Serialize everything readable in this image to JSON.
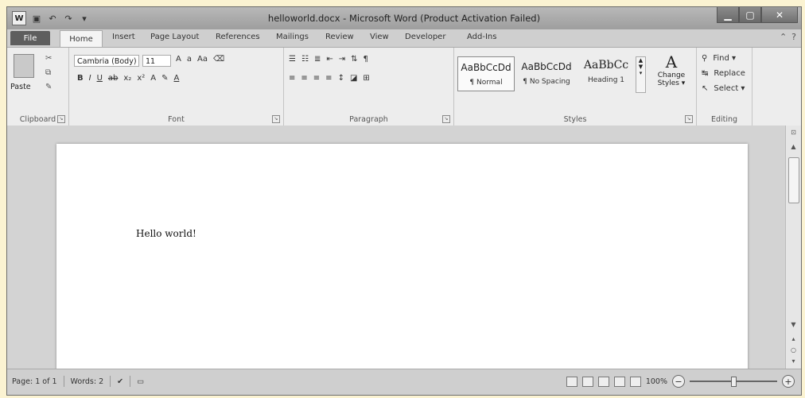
{
  "window": {
    "title": "helloworld.docx - Microsoft Word (Product Activation Failed)"
  },
  "qat": {
    "logo": "W"
  },
  "tabs": [
    "File",
    "Home",
    "Insert",
    "Page Layout",
    "References",
    "Mailings",
    "Review",
    "View",
    "Developer",
    "Add-Ins"
  ],
  "ribbon": {
    "clipboard": {
      "paste_label": "Paste",
      "group_label": "Clipboard"
    },
    "font": {
      "font_name": "Cambria (Body)",
      "font_size": "11",
      "group_label": "Font"
    },
    "paragraph": {
      "group_label": "Paragraph"
    },
    "styles": {
      "items": [
        {
          "preview": "AaBbCcDd",
          "name": "¶ Normal"
        },
        {
          "preview": "AaBbCcDd",
          "name": "¶ No Spacing"
        },
        {
          "preview": "AaBbCc",
          "name": "Heading 1"
        }
      ],
      "change_styles": "Change Styles ▾",
      "group_label": "Styles"
    },
    "editing": {
      "find": "Find ▾",
      "replace": "Replace",
      "select": "Select ▾",
      "group_label": "Editing"
    }
  },
  "document": {
    "text": "Hello world!"
  },
  "status": {
    "page": "Page: 1 of 1",
    "words": "Words: 2",
    "zoom": "100%"
  }
}
